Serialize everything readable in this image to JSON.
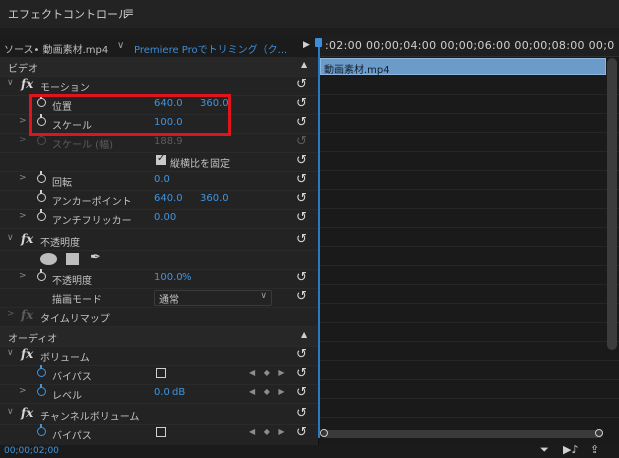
{
  "panel": {
    "title": "エフェクトコントロール",
    "menu_icon": "≡"
  },
  "tabs": {
    "source": "ソース• 動画素材.mp4",
    "chevron": "∨",
    "clip": "Premiere Proでトリミング（ク...",
    "play": "▶"
  },
  "timeline": {
    "ruler": ":02:00  00;00;04:00  00;00;06:00  00;00;08:00  00;0",
    "clip_name": "動画素材.mp4"
  },
  "video": {
    "header": "ビデオ",
    "motion": {
      "label": "モーション",
      "position": {
        "label": "位置",
        "x": "640.0",
        "y": "360.0"
      },
      "scale": {
        "label": "スケール",
        "value": "100.0"
      },
      "scale_width": {
        "label": "スケール (幅)",
        "value": "188.9"
      },
      "uniform_scale": {
        "label": "縦横比を固定",
        "checked": true
      },
      "rotation": {
        "label": "回転",
        "value": "0.0"
      },
      "anchor": {
        "label": "アンカーポイント",
        "x": "640.0",
        "y": "360.0"
      },
      "antiflicker": {
        "label": "アンチフリッカー",
        "value": "0.00"
      }
    },
    "opacity": {
      "label": "不透明度",
      "value_label": "不透明度",
      "value": "100.0",
      "unit": "%",
      "blend_label": "描画モード",
      "blend_value": "通常"
    },
    "time_remap": {
      "label": "タイムリマップ"
    }
  },
  "audio": {
    "header": "オーディオ",
    "volume": {
      "label": "ボリューム",
      "bypass_label": "バイパス",
      "level_label": "レベル",
      "level_value": "0.0",
      "level_unit": "dB"
    },
    "channel_volume": {
      "label": "チャンネルボリューム",
      "bypass_label": "バイパス"
    }
  },
  "glyphs": {
    "fx": "fx",
    "twirl_open": "∨",
    "twirl_closed": ">",
    "reset": "↺",
    "up": "▲",
    "keyframe_nav": "◀ ◆ ▶",
    "dropdown": "∨",
    "pen": "✒",
    "filter": "⏷",
    "play_audio": "▶♪",
    "export": "⇪"
  },
  "status": {
    "time": "00;00;02;00"
  },
  "colors": {
    "accent": "#3f95df",
    "highlight": "#e1141b",
    "clip": "#6b9bc9"
  }
}
